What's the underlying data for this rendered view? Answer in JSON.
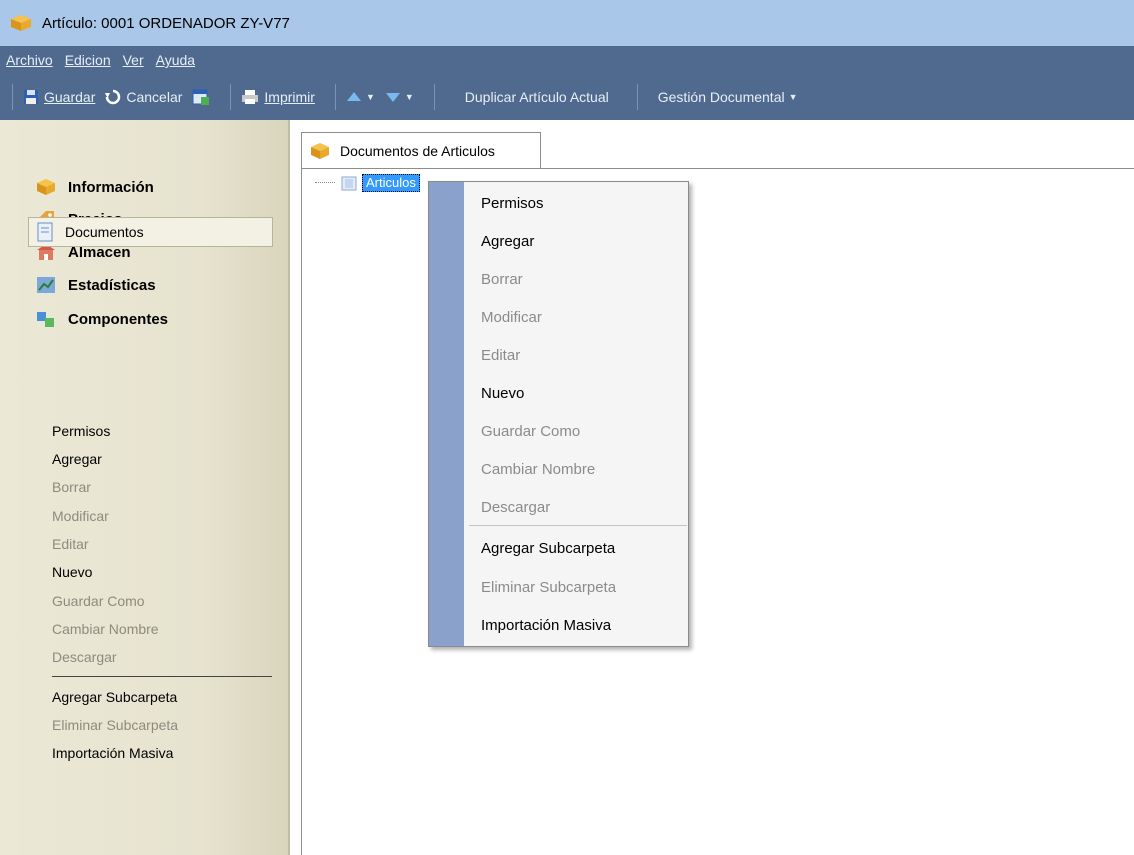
{
  "window": {
    "title": "Artículo: 0001 ORDENADOR ZY-V77"
  },
  "menubar": {
    "items": [
      {
        "label": "Archivo"
      },
      {
        "label": "Edicion"
      },
      {
        "label": "Ver"
      },
      {
        "label": "Ayuda"
      }
    ]
  },
  "toolbar": {
    "save_label": "Guardar",
    "cancel_label": "Cancelar",
    "print_label": "Imprimir",
    "duplicate_label": "Duplicar Artículo Actual",
    "doc_mgmt_label": "Gestión Documental"
  },
  "sidebar": {
    "nav": [
      {
        "label": "Información",
        "icon": "box-icon"
      },
      {
        "label": "Precios",
        "icon": "price-tag-icon"
      },
      {
        "label": "Almacen",
        "icon": "warehouse-icon"
      },
      {
        "label": "Estadísticas",
        "icon": "chart-icon"
      },
      {
        "label": "Componentes",
        "icon": "components-icon"
      }
    ],
    "selected": {
      "label": "Documentos",
      "icon": "document-icon"
    },
    "actions": [
      {
        "label": "Permisos",
        "enabled": true
      },
      {
        "label": "Agregar",
        "enabled": true
      },
      {
        "label": "Borrar",
        "enabled": false
      },
      {
        "label": "Modificar",
        "enabled": false
      },
      {
        "label": "Editar",
        "enabled": false
      },
      {
        "label": "Nuevo",
        "enabled": true
      },
      {
        "label": "Guardar Como",
        "enabled": false
      },
      {
        "label": "Cambiar Nombre",
        "enabled": false
      },
      {
        "label": "Descargar",
        "enabled": false
      },
      {
        "label": "Agregar Subcarpeta",
        "enabled": true
      },
      {
        "label": "Eliminar Subcarpeta",
        "enabled": false
      },
      {
        "label": "Importación Masiva",
        "enabled": true
      }
    ]
  },
  "main": {
    "tab_label": "Documentos de Articulos",
    "tree_node": "Articulos"
  },
  "context_menu": {
    "items": [
      {
        "label": "Permisos",
        "enabled": true
      },
      {
        "label": "Agregar",
        "enabled": true
      },
      {
        "label": "Borrar",
        "enabled": false
      },
      {
        "label": "Modificar",
        "enabled": false
      },
      {
        "label": "Editar",
        "enabled": false
      },
      {
        "label": "Nuevo",
        "enabled": true
      },
      {
        "label": "Guardar Como",
        "enabled": false
      },
      {
        "label": "Cambiar Nombre",
        "enabled": false
      },
      {
        "label": "Descargar",
        "enabled": false
      },
      {
        "label": "Agregar Subcarpeta",
        "enabled": true
      },
      {
        "label": "Eliminar Subcarpeta",
        "enabled": false
      },
      {
        "label": "Importación Masiva",
        "enabled": true
      }
    ]
  },
  "colors": {
    "titlebar": "#a9c7e8",
    "toolbar": "#4f6a8e",
    "sidebar": "#e6e3cf",
    "menu_gutter": "#8aa1cb",
    "selection": "#3399ff"
  }
}
